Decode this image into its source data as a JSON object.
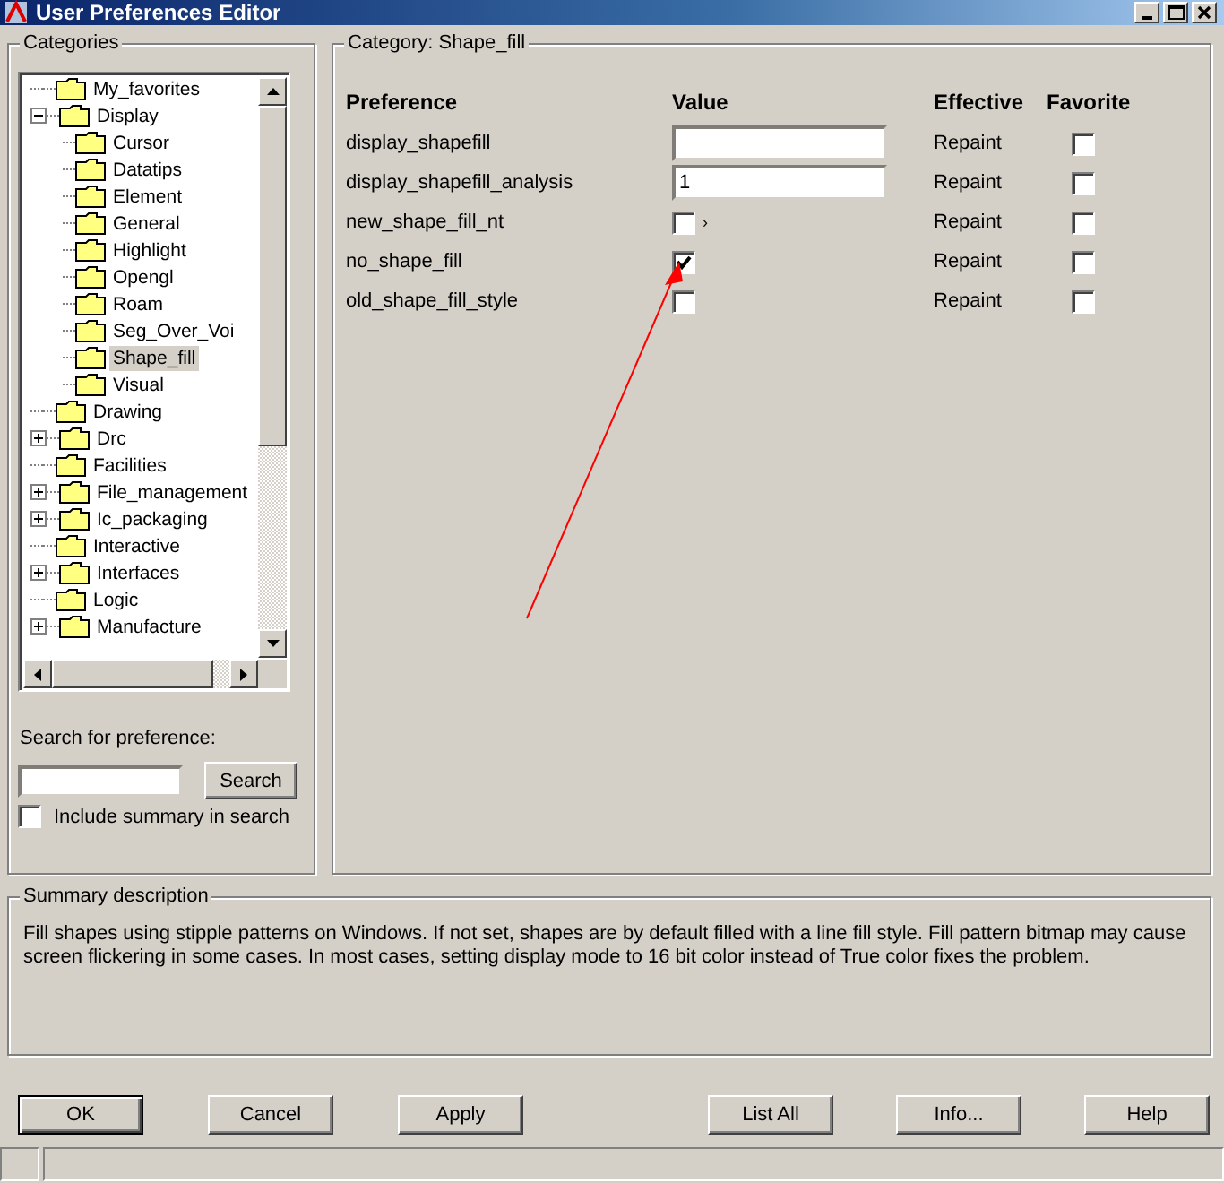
{
  "window": {
    "title": "User Preferences Editor"
  },
  "categories": {
    "title": "Categories",
    "items": [
      {
        "label": "My_favorites",
        "selected": false
      },
      {
        "label": "Display",
        "expanded": true,
        "selected": false,
        "children": [
          {
            "label": "Cursor",
            "selected": false
          },
          {
            "label": "Datatips",
            "selected": false
          },
          {
            "label": "Element",
            "selected": false
          },
          {
            "label": "General",
            "selected": false
          },
          {
            "label": "Highlight",
            "selected": false
          },
          {
            "label": "Opengl",
            "selected": false
          },
          {
            "label": "Roam",
            "selected": false
          },
          {
            "label": "Seg_Over_Voi",
            "selected": false
          },
          {
            "label": "Shape_fill",
            "selected": true
          },
          {
            "label": "Visual",
            "selected": false
          }
        ]
      },
      {
        "label": "Drawing",
        "selected": false
      },
      {
        "label": "Drc",
        "expanded": false,
        "selected": false
      },
      {
        "label": "Facilities",
        "selected": false
      },
      {
        "label": "File_management",
        "expanded": false,
        "selected": false
      },
      {
        "label": "Ic_packaging",
        "expanded": false,
        "selected": false
      },
      {
        "label": "Interactive",
        "selected": false
      },
      {
        "label": "Interfaces",
        "expanded": false,
        "selected": false
      },
      {
        "label": "Logic",
        "selected": false
      },
      {
        "label": "Manufacture",
        "expanded": false,
        "selected": false
      }
    ],
    "search_label": "Search for preference:",
    "search_button": "Search",
    "include_summary": {
      "label": "Include summary in search",
      "checked": false
    }
  },
  "category": {
    "label": "Category:",
    "name": "Shape_fill",
    "columns": [
      "Preference",
      "Value",
      "Effective",
      "Favorite"
    ],
    "rows": [
      {
        "name": "display_shapefill",
        "kind": "text",
        "value": "",
        "effective": "Repaint",
        "favorite": false
      },
      {
        "name": "display_shapefill_analysis",
        "kind": "text",
        "value": "1",
        "effective": "Repaint",
        "favorite": false
      },
      {
        "name": "new_shape_fill_nt",
        "kind": "checkbox",
        "checked": false,
        "suffix": "›",
        "effective": "Repaint",
        "favorite": false
      },
      {
        "name": "no_shape_fill",
        "kind": "checkbox",
        "checked": true,
        "effective": "Repaint",
        "favorite": false
      },
      {
        "name": "old_shape_fill_style",
        "kind": "checkbox",
        "checked": false,
        "effective": "Repaint",
        "favorite": false
      }
    ]
  },
  "summary": {
    "title": "Summary description",
    "text": "Fill shapes using stipple patterns on Windows. If not set, shapes are by default filled with a line fill style. Fill pattern bitmap may cause screen flickering in some cases. In most cases, setting display mode to 16 bit color instead of True color fixes the problem."
  },
  "buttons": [
    {
      "label": "OK",
      "default": true
    },
    {
      "label": "Cancel",
      "default": false
    },
    {
      "label": "Apply",
      "default": false
    },
    {
      "label": "List All",
      "default": false
    },
    {
      "label": "Info...",
      "default": false
    },
    {
      "label": "Help",
      "default": false
    }
  ]
}
